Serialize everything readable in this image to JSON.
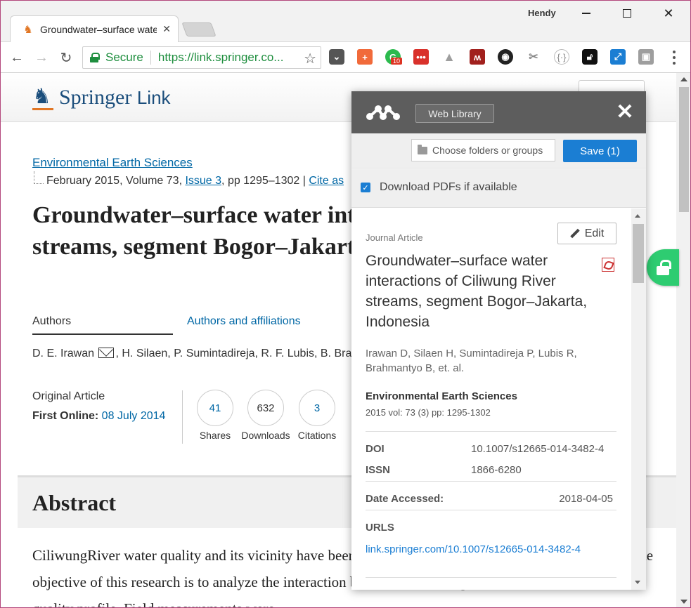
{
  "window": {
    "user_name": "Hendy",
    "tab_title": "Groundwater–surface water interactions"
  },
  "omnibox": {
    "secure_label": "Secure",
    "url": "https://link.springer.co..."
  },
  "extensions": [
    {
      "name": "pocket-icon",
      "color": "#555555"
    },
    {
      "name": "plus-icon",
      "color": "#f16a3a"
    },
    {
      "name": "grammarly-icon",
      "color": "#2cba4e",
      "badge": "10"
    },
    {
      "name": "dots-icon",
      "color": "#d9312b"
    },
    {
      "name": "drive-icon",
      "color": "#9e9e9e"
    },
    {
      "name": "mendeley-icon",
      "color": "#a1201d"
    },
    {
      "name": "camera-icon",
      "color": "#222222"
    },
    {
      "name": "scissors-icon",
      "color": "#888888"
    },
    {
      "name": "bracket-icon",
      "color": "#888888"
    },
    {
      "name": "unlock-icon",
      "color": "#111111"
    },
    {
      "name": "resize-icon",
      "color": "#1b7ed3"
    },
    {
      "name": "box-icon",
      "color": "#9e9e9e"
    }
  ],
  "springer": {
    "logo_main": "Springer",
    "logo_sub": "Link",
    "journal": "Environmental Earth Sciences",
    "citation_prefix": "February 2015, Volume 73, ",
    "issue_link": "Issue 3",
    "citation_pages": ", pp 1295–1302 | ",
    "cite_link": "Cite as",
    "title": "Groundwater–surface water interactions of Ciliwung River streams, segment Bogor–Jakarta, Indonesia",
    "tab_authors": "Authors",
    "tab_affiliations": "Authors and affiliations",
    "author_first": "D. E. Irawan",
    "authors_rest": ", H. Silaen, P. Sumintadireja, R. F. Lubis, B. Brahmantyo, et al.",
    "article_type": "Original Article",
    "first_online_label": "First Online: ",
    "first_online_date": "08 July 2014",
    "metrics": [
      {
        "value": "41",
        "label": "Shares"
      },
      {
        "value": "632",
        "label": "Downloads"
      },
      {
        "value": "3",
        "label": "Citations"
      }
    ],
    "abstract_title": "Abstract",
    "abstract_text": "CiliwungRiver water quality and its vicinity have been deteriorated due to the increasing population. The objective of this research is to analyze the interaction between river and groundwater, and the water quality profile. Field measurements were"
  },
  "mendeley": {
    "web_library": "Web Library",
    "folder_placeholder": "Choose folders or groups",
    "save_button": "Save (1)",
    "download_pdfs": "Download PDFs if available",
    "doc_type": "Journal Article",
    "edit": "Edit",
    "doc_title": "Groundwater–surface water interactions of Ciliwung River streams, segment Bogor–Jakarta, Indonesia",
    "doc_authors": "Irawan D,  Silaen H,  Sumintadireja P,  Lubis R,  Brahmantyo B,  et. al.",
    "journal": "Environmental Earth Sciences",
    "volume": "2015 vol: 73 (3) pp: 1295-1302",
    "doi_label": "DOI",
    "doi": "10.1007/s12665-014-3482-4",
    "issn_label": "ISSN",
    "issn": "1866-6280",
    "date_label": "Date Accessed:",
    "date": "2018-04-05",
    "urls_label": "URLS",
    "url": "link.springer.com/10.1007/s12665-014-3482-4"
  },
  "colors": {
    "springer_blue": "#1b4e7c",
    "link_blue": "#0067a5",
    "mendeley_header": "#5d5d5d",
    "save_blue": "#1b7ed3",
    "secure_green": "#1e8e3e"
  }
}
